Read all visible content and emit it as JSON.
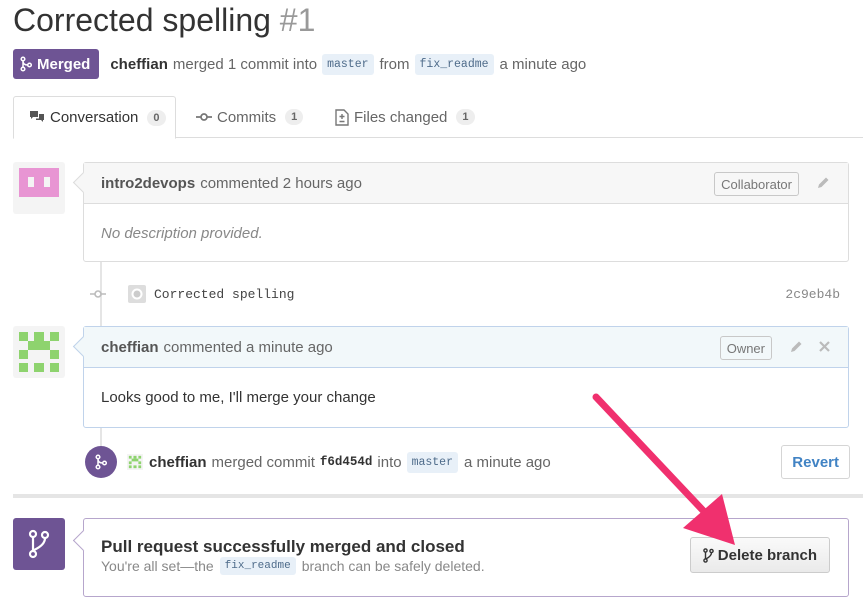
{
  "pr": {
    "title": "Corrected spelling",
    "number": "#1",
    "state_label": "Merged",
    "author": "cheffian",
    "merge_text": "merged 1 commit into",
    "base_branch": "master",
    "from_text": "from",
    "head_branch": "fix_readme",
    "time": "a minute ago"
  },
  "tabs": [
    {
      "label": "Conversation",
      "count": "0",
      "icon": "comment-discussion-icon"
    },
    {
      "label": "Commits",
      "count": "1",
      "icon": "git-commit-icon"
    },
    {
      "label": "Files changed",
      "count": "1",
      "icon": "file-diff-icon"
    }
  ],
  "comments": [
    {
      "author": "intro2devops",
      "action": "commented 2 hours ago",
      "role": "Collaborator",
      "body": "No description provided."
    },
    {
      "author": "cheffian",
      "action": "commented a minute ago",
      "role": "Owner",
      "body": "Looks good to me, I'll merge your change"
    }
  ],
  "commit": {
    "message": "Corrected spelling",
    "sha": "2c9eb4b"
  },
  "merge_event": {
    "author": "cheffian",
    "text": "merged commit",
    "sha": "f6d454d",
    "into_text": "into",
    "branch": "master",
    "time": "a minute ago",
    "revert_label": "Revert"
  },
  "merged_box": {
    "title": "Pull request successfully merged and closed",
    "sub_before": "You're all set—the",
    "branch": "fix_readme",
    "sub_after": "branch can be safely deleted.",
    "delete_label": "Delete branch"
  },
  "colors": {
    "merged_purple": "#6e5494",
    "link_blue": "#4183c4",
    "annotation_arrow": "#f0306e"
  }
}
